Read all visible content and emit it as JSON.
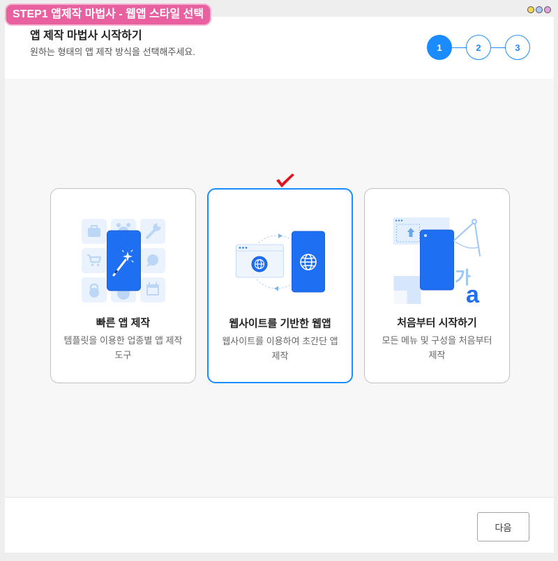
{
  "theme": {
    "accent": "#1a8cff",
    "phone": "#1f6ff2",
    "badge": "#e8609f",
    "check": "#e0141e"
  },
  "badge": {
    "label": "STEP1 앱제작 마법사 - 웹앱 스타일 선택"
  },
  "header": {
    "title": "앱 제작 마법사 시작하기",
    "subtitle": "원하는 형태의 앱 제작 방식을 선택해주세요."
  },
  "stepper": {
    "current": 1,
    "steps": [
      "1",
      "2",
      "3"
    ]
  },
  "options": [
    {
      "title": "빠른 앱 제작",
      "description": "템플릿을 이용한 업종별 앱 제작 도구",
      "selected": false,
      "icons": [
        "briefcase-icon",
        "alarm-clock-icon",
        "wrench-icon",
        "cart-icon",
        "chat-icon",
        "kettlebell-icon",
        "calendar-icon",
        "phone-icon",
        "magic-wand-icon"
      ]
    },
    {
      "title": "웹사이트를 기반한 웹앱",
      "description": "웹사이트를 이용하여 초간단 앱 제작",
      "selected": true,
      "icons": [
        "browser-window-icon",
        "globe-icon",
        "sync-arrows-icon",
        "phone-icon"
      ]
    },
    {
      "title": "처음부터 시작하기",
      "description": "모든 메뉴 및 구성을 처음부터 제작",
      "selected": false,
      "icons": [
        "blueprint-window-icon",
        "upload-arrow-icon",
        "phone-icon",
        "compass-icon"
      ],
      "illustration_text": [
        "가",
        "a"
      ]
    }
  ],
  "footer": {
    "next_label": "다음"
  }
}
